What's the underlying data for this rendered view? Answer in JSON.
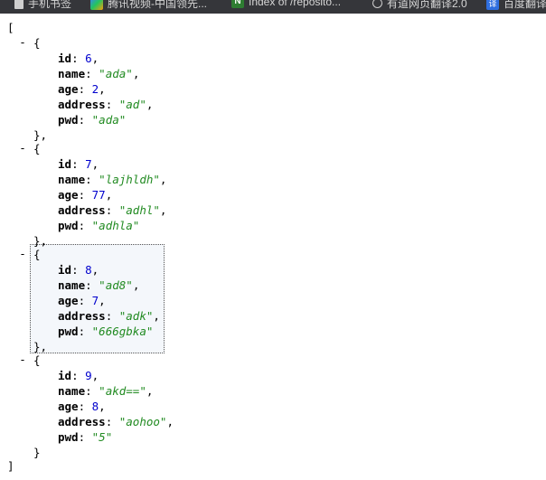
{
  "bookmarks": [
    {
      "label": "手机书签",
      "icon": "folder-icon"
    },
    {
      "label": "腾讯视频-中国领先...",
      "icon": "video-icon"
    },
    {
      "label": "Index of /reposito...",
      "icon": "nexus-icon"
    },
    {
      "label": "有道网页翻译2.0",
      "icon": "globe-icon"
    },
    {
      "label": "百度翻译",
      "icon": "translate-icon"
    }
  ],
  "json_view": {
    "open_bracket": "[",
    "close_bracket": "]",
    "toggle_symbol": "-",
    "records": [
      {
        "id": "6",
        "name": "\"ada\"",
        "age": "2",
        "address": "\"ad\"",
        "pwd": "\"ada\""
      },
      {
        "id": "7",
        "name": "\"lajhldh\"",
        "age": "77",
        "address": "\"adhl\"",
        "pwd": "\"adhla\""
      },
      {
        "id": "8",
        "name": "\"ad8\"",
        "age": "7",
        "address": "\"adk\"",
        "pwd": "\"666gbka\""
      },
      {
        "id": "9",
        "name": "\"akd==\"",
        "age": "8",
        "address": "\"aohoo\"",
        "pwd": "\"5\""
      }
    ],
    "field_keys": [
      "id",
      "name",
      "age",
      "address",
      "pwd"
    ],
    "selected_record": 2
  }
}
